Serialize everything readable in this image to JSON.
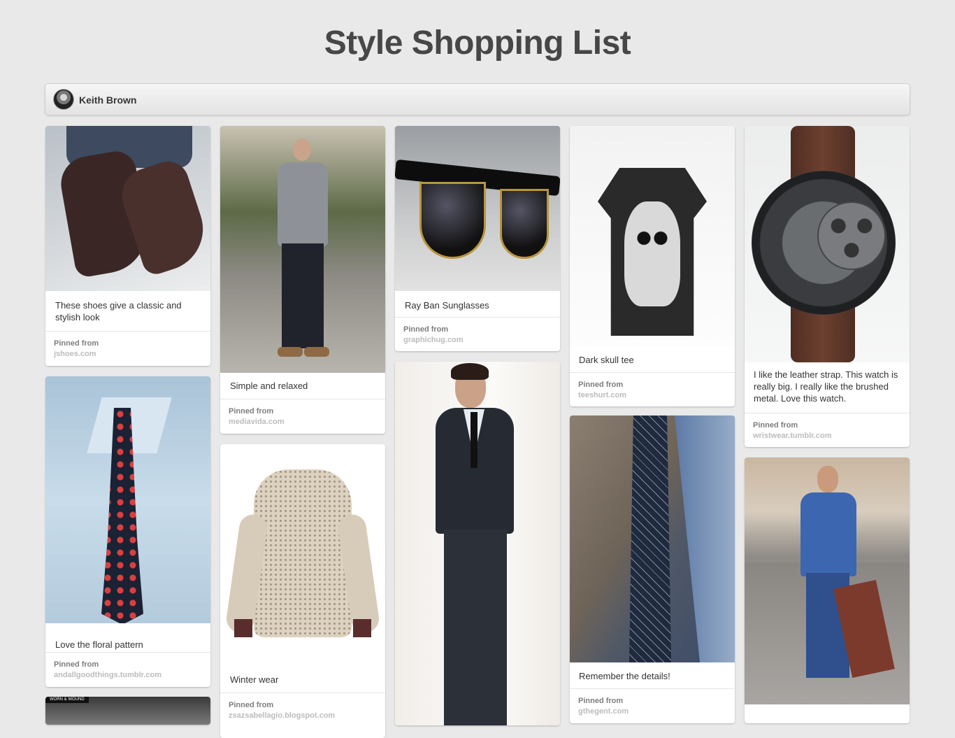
{
  "board": {
    "title": "Style Shopping List",
    "owner": "Keith Brown"
  },
  "pins": [
    {
      "description": "These shoes give a classic and stylish look",
      "source_label": "Pinned from",
      "source": "jshoes.com"
    },
    {
      "description": "Love the floral pattern",
      "source_label": "Pinned from",
      "source": "andallgoodthings.tumblr.com"
    },
    {
      "description": "Simple and relaxed",
      "source_label": "Pinned from",
      "source": "mediavida.com"
    },
    {
      "description": "Winter wear",
      "source_label": "Pinned from",
      "source": "zsazsabellagio.blogspot.com"
    },
    {
      "description": "Ray Ban Sunglasses",
      "source_label": "Pinned from",
      "source": "graphichug.com"
    },
    {
      "description": "Dark skull tee",
      "source_label": "Pinned from",
      "source": "teeshurt.com"
    },
    {
      "description": "Remember the details!",
      "source_label": "Pinned from",
      "source": "gthegent.com"
    },
    {
      "description": "I like the leather strap. This watch is really big. I really like the brushed metal. Love this watch.",
      "source_label": "Pinned from",
      "source": "wristwear.tumblr.com"
    }
  ],
  "image_labels": {
    "watermark_col1": "WORN & WOUND"
  }
}
